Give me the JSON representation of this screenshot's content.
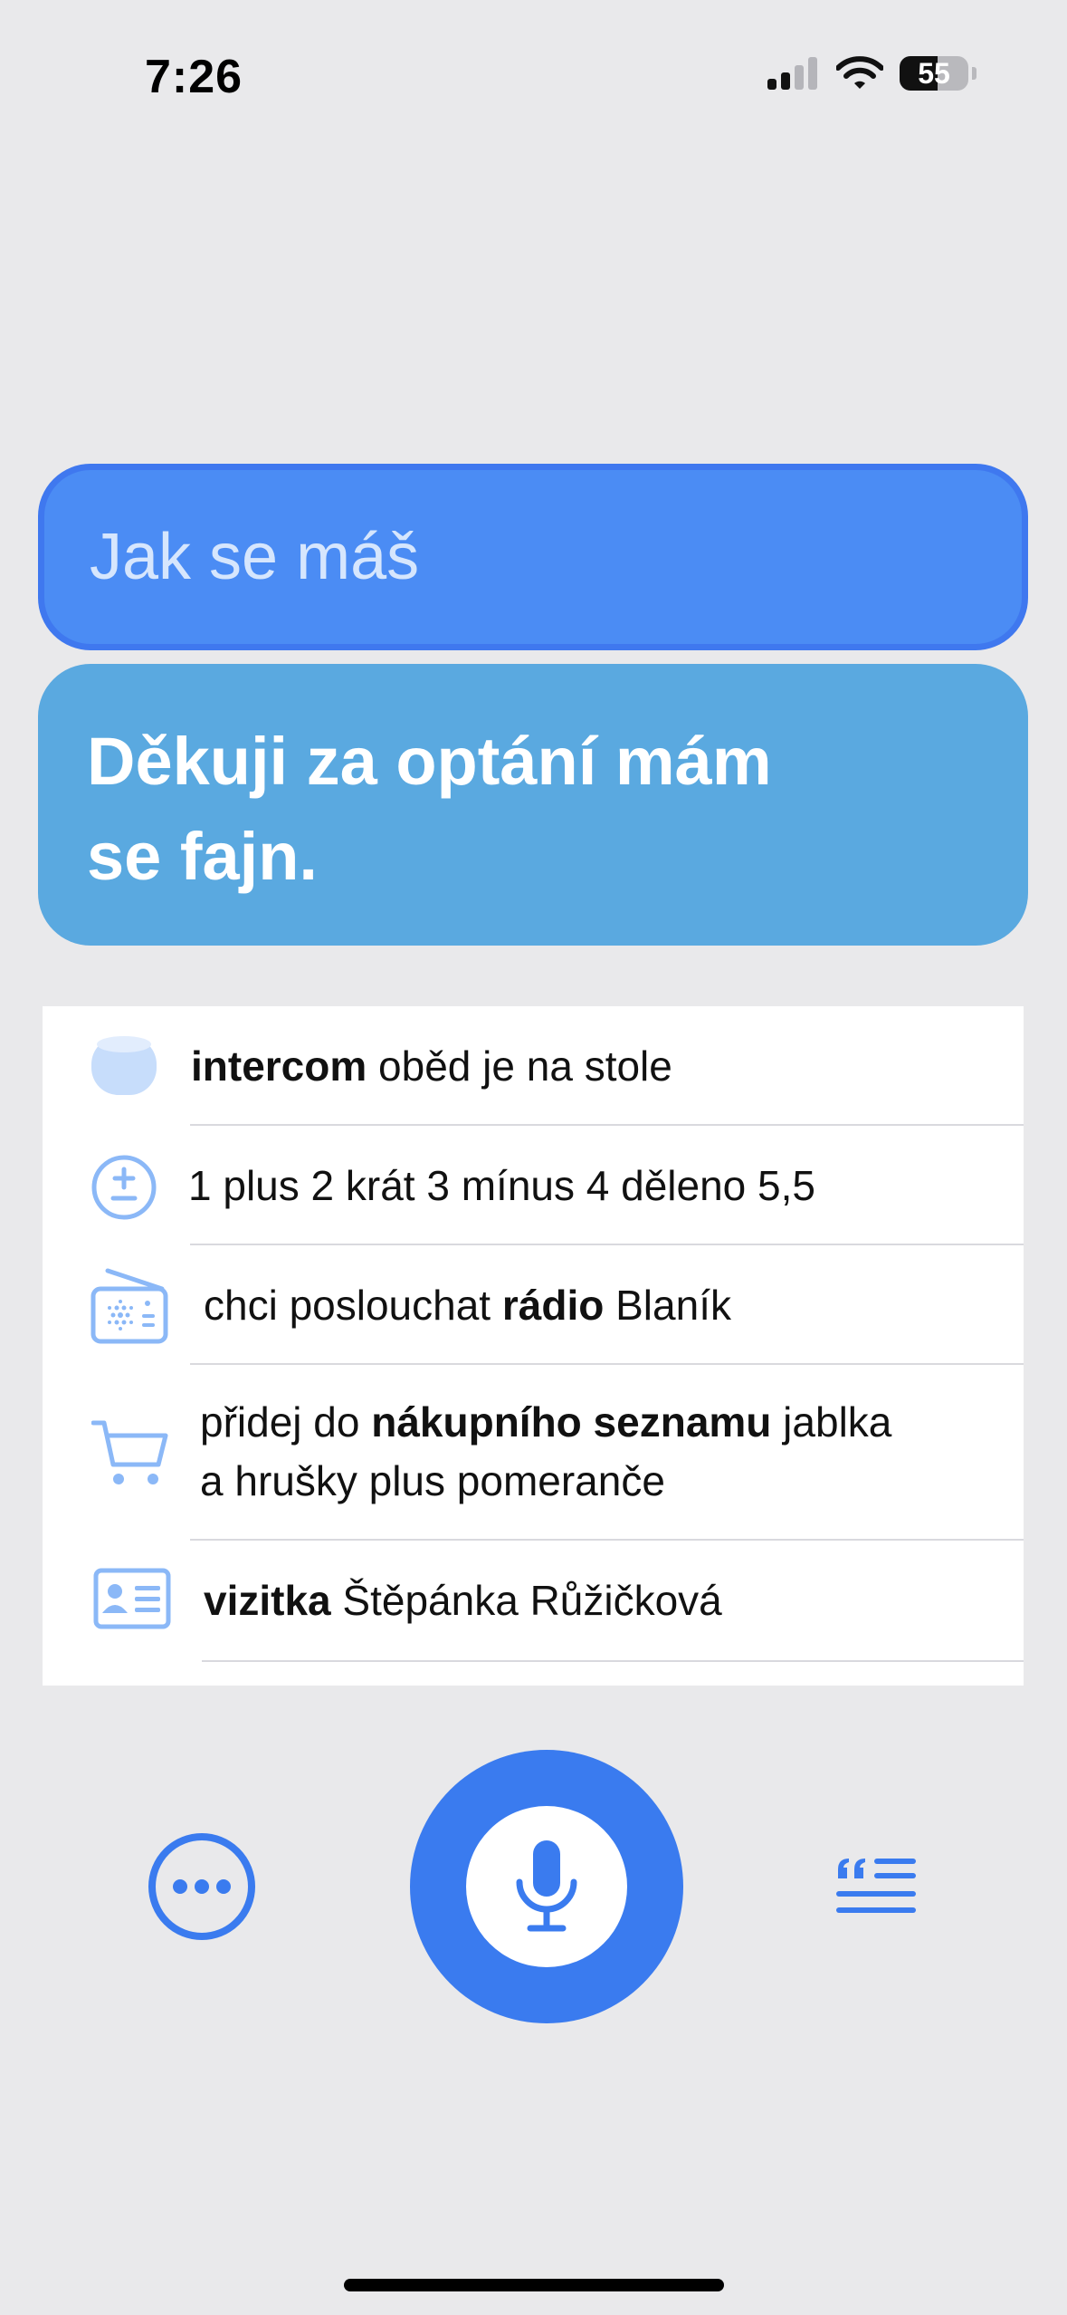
{
  "status_bar": {
    "time": "7:26",
    "battery_level": "55",
    "battery_fraction": 0.55,
    "icons": [
      "cellular-signal-icon",
      "wifi-icon",
      "battery-icon"
    ]
  },
  "conversation": {
    "query": "Jak se máš",
    "response_line1": "Děkuji za optání mám",
    "response_line2": "se fajn."
  },
  "suggestions": [
    {
      "icon": "homepod-icon",
      "parts": [
        {
          "text": "intercom",
          "bold": true
        },
        {
          "text": " oběd je na stole",
          "bold": false
        }
      ]
    },
    {
      "icon": "plus-minus-icon",
      "parts": [
        {
          "text": "1 plus 2 krát 3 mínus 4 děleno 5,5",
          "bold": false
        }
      ]
    },
    {
      "icon": "radio-icon",
      "parts": [
        {
          "text": "chci poslouchat ",
          "bold": false
        },
        {
          "text": "rádio",
          "bold": true
        },
        {
          "text": " Blaník",
          "bold": false
        }
      ]
    },
    {
      "icon": "cart-icon",
      "line1": [
        {
          "text": "přidej do ",
          "bold": false
        },
        {
          "text": "nákupního seznamu",
          "bold": true
        },
        {
          "text": " jablka",
          "bold": false
        }
      ],
      "line2": [
        {
          "text": "a hrušky plus pomeranče",
          "bold": false
        }
      ]
    },
    {
      "icon": "contact-card-icon",
      "parts": [
        {
          "text": "vizitka",
          "bold": true
        },
        {
          "text": " Štěpánka Růžičková",
          "bold": false
        }
      ]
    }
  ],
  "controls": {
    "more_icon": "ellipsis-circle-icon",
    "mic_icon": "microphone-icon",
    "transcript_icon": "quote-text-icon"
  },
  "colors": {
    "accent": "#3a7bef",
    "query_bubble": "#4b8cf4",
    "response_bubble": "#5aa9e0",
    "icon_light_blue": "#8bb8f7",
    "background": "#e9e9eb"
  }
}
